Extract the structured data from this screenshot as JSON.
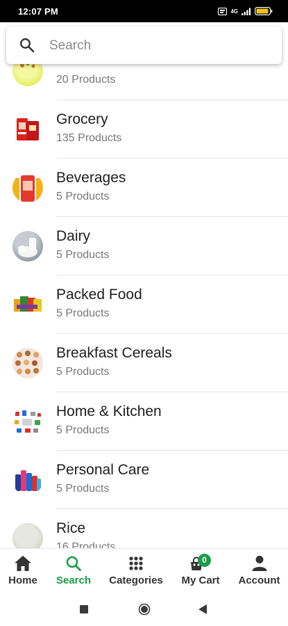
{
  "status_bar": {
    "time": "12:07 PM",
    "network": "4G"
  },
  "search": {
    "placeholder": "Search"
  },
  "categories": [
    {
      "title": "",
      "count": "20 Products",
      "icon": "fruits-thumbnail"
    },
    {
      "title": "Grocery",
      "count": "135 Products",
      "icon": "grocery-thumbnail"
    },
    {
      "title": "Beverages",
      "count": "5 Products",
      "icon": "beverages-thumbnail"
    },
    {
      "title": "Dairy",
      "count": "5 Products",
      "icon": "dairy-thumbnail"
    },
    {
      "title": "Packed Food",
      "count": "5 Products",
      "icon": "packed-food-thumbnail"
    },
    {
      "title": "Breakfast Cereals",
      "count": "5 Products",
      "icon": "cereals-thumbnail"
    },
    {
      "title": "Home & Kitchen",
      "count": "5 Products",
      "icon": "home-kitchen-thumbnail"
    },
    {
      "title": "Personal Care",
      "count": "5 Products",
      "icon": "personal-care-thumbnail"
    },
    {
      "title": "Rice",
      "count": "16 Products",
      "icon": "rice-thumbnail"
    }
  ],
  "bottom_nav": {
    "active": "Search",
    "active_color": "#1a9c47",
    "items": [
      {
        "label": "Home",
        "icon": "home-icon"
      },
      {
        "label": "Search",
        "icon": "search-icon"
      },
      {
        "label": "Categories",
        "icon": "grid-icon"
      },
      {
        "label": "My Cart",
        "icon": "cart-icon",
        "badge": "0"
      },
      {
        "label": "Account",
        "icon": "person-icon"
      }
    ]
  },
  "system_nav": {
    "buttons": [
      "recents-button",
      "home-button",
      "back-button"
    ]
  }
}
